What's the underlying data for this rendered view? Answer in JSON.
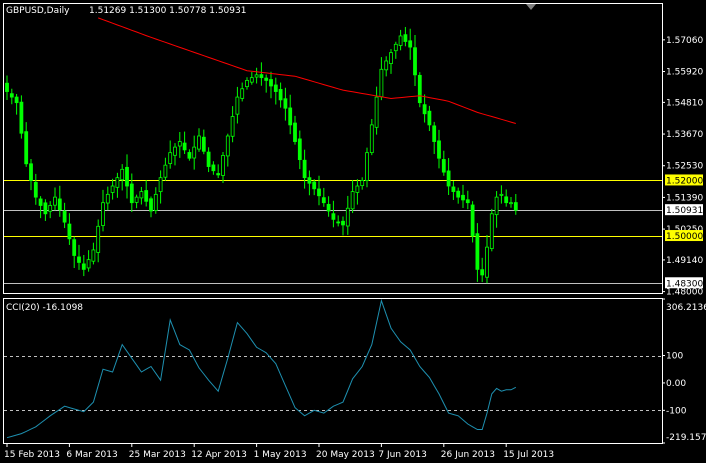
{
  "window": {
    "symbol_label": "GBPUSD,Daily",
    "ohlc_label": "1.51269 1.51300 1.50778 1.50931"
  },
  "colors": {
    "background": "#000000",
    "frame": "#ffffff",
    "candle": "#00ff00",
    "moving_average": "#ff0000",
    "hline_yellow": "#ffff00",
    "hline_white": "#c0c0c0",
    "cci_line": "#1e90b0",
    "text": "#ffffff",
    "tag_yellow_bg": "#ffff00",
    "tag_white_bg": "#ffffff",
    "tag_text": "#000000"
  },
  "chart_data": [
    {
      "type": "candlestick",
      "title": "GBPUSD,Daily",
      "ylim": [
        1.4795,
        1.5835
      ],
      "y_ticks": [
        "1.57060",
        "1.55920",
        "1.54810",
        "1.53670",
        "1.52530",
        "1.51390",
        "1.50250",
        "1.49140",
        "1.48000"
      ],
      "x_tick_labels": [
        "15 Feb 2013",
        "6 Mar 2013",
        "25 Mar 2013",
        "12 Apr 2013",
        "1 May 2013",
        "20 May 2013",
        "7 Jun 2013",
        "26 Jun 2013",
        "15 Jul 2013"
      ],
      "x_tick_bar_index": [
        0,
        13,
        26,
        39,
        52,
        65,
        78,
        91,
        104
      ],
      "bar_count": 107,
      "ma_start_index": 19,
      "horizontal_lines": [
        {
          "value": 1.52,
          "label": "1.52000",
          "style": "yellow"
        },
        {
          "value": 1.50931,
          "label": "1.50931",
          "style": "white"
        },
        {
          "value": 1.5,
          "label": "1.50000",
          "style": "yellow"
        },
        {
          "value": 1.483,
          "label": "1.48300",
          "style": "white"
        }
      ],
      "close_keyframes": [
        [
          0,
          1.552
        ],
        [
          2,
          1.548
        ],
        [
          4,
          1.526
        ],
        [
          6,
          1.514
        ],
        [
          8,
          1.508
        ],
        [
          10,
          1.514
        ],
        [
          12,
          1.505
        ],
        [
          14,
          1.493
        ],
        [
          16,
          1.488
        ],
        [
          18,
          1.495
        ],
        [
          20,
          1.512
        ],
        [
          22,
          1.518
        ],
        [
          24,
          1.524
        ],
        [
          26,
          1.512
        ],
        [
          28,
          1.516
        ],
        [
          30,
          1.509
        ],
        [
          32,
          1.521
        ],
        [
          34,
          1.53
        ],
        [
          36,
          1.534
        ],
        [
          38,
          1.528
        ],
        [
          40,
          1.536
        ],
        [
          42,
          1.525
        ],
        [
          44,
          1.522
        ],
        [
          46,
          1.536
        ],
        [
          48,
          1.55
        ],
        [
          50,
          1.556
        ],
        [
          52,
          1.558
        ],
        [
          54,
          1.556
        ],
        [
          56,
          1.552
        ],
        [
          58,
          1.546
        ],
        [
          60,
          1.534
        ],
        [
          62,
          1.521
        ],
        [
          64,
          1.517
        ],
        [
          66,
          1.512
        ],
        [
          68,
          1.506
        ],
        [
          70,
          1.504
        ],
        [
          72,
          1.516
        ],
        [
          74,
          1.52
        ],
        [
          76,
          1.54
        ],
        [
          78,
          1.56
        ],
        [
          80,
          1.566
        ],
        [
          82,
          1.572
        ],
        [
          84,
          1.568
        ],
        [
          86,
          1.548
        ],
        [
          88,
          1.54
        ],
        [
          90,
          1.528
        ],
        [
          92,
          1.518
        ],
        [
          94,
          1.514
        ],
        [
          96,
          1.512
        ],
        [
          98,
          1.488
        ],
        [
          99,
          1.486
        ],
        [
          100,
          1.496
        ],
        [
          101,
          1.508
        ],
        [
          102,
          1.514
        ],
        [
          103,
          1.515
        ],
        [
          104,
          1.512
        ],
        [
          105,
          1.512
        ],
        [
          106,
          1.5093
        ]
      ],
      "moving_average_keyframes": [
        [
          19,
          1.5785
        ],
        [
          30,
          1.5715
        ],
        [
          40,
          1.5655
        ],
        [
          50,
          1.5595
        ],
        [
          60,
          1.5575
        ],
        [
          70,
          1.5525
        ],
        [
          80,
          1.5495
        ],
        [
          86,
          1.5505
        ],
        [
          92,
          1.5485
        ],
        [
          98,
          1.5445
        ],
        [
          106,
          1.5405
        ]
      ]
    },
    {
      "type": "line",
      "title": "CCI(20) -16.1098",
      "ylim": [
        -219.1573,
        306.2136
      ],
      "y_ticks": [
        "306.2136",
        "100",
        "0.00",
        "-100",
        "-219.1573"
      ],
      "dashed_levels": [
        100,
        -100
      ],
      "series": [
        {
          "keyframes": [
            [
              0,
              -200
            ],
            [
              3,
              -185
            ],
            [
              6,
              -160
            ],
            [
              9,
              -120
            ],
            [
              12,
              -85
            ],
            [
              14,
              -95
            ],
            [
              16,
              -105
            ],
            [
              18,
              -70
            ],
            [
              20,
              50
            ],
            [
              22,
              40
            ],
            [
              24,
              140
            ],
            [
              26,
              90
            ],
            [
              28,
              40
            ],
            [
              30,
              60
            ],
            [
              32,
              10
            ],
            [
              34,
              230
            ],
            [
              36,
              140
            ],
            [
              38,
              120
            ],
            [
              40,
              55
            ],
            [
              42,
              10
            ],
            [
              44,
              -30
            ],
            [
              46,
              90
            ],
            [
              48,
              220
            ],
            [
              50,
              180
            ],
            [
              52,
              130
            ],
            [
              54,
              110
            ],
            [
              56,
              70
            ],
            [
              58,
              -10
            ],
            [
              60,
              -90
            ],
            [
              62,
              -120
            ],
            [
              64,
              -100
            ],
            [
              66,
              -110
            ],
            [
              68,
              -85
            ],
            [
              70,
              -70
            ],
            [
              72,
              15
            ],
            [
              74,
              60
            ],
            [
              76,
              140
            ],
            [
              78,
              300
            ],
            [
              80,
              200
            ],
            [
              82,
              150
            ],
            [
              84,
              120
            ],
            [
              86,
              60
            ],
            [
              88,
              20
            ],
            [
              90,
              -40
            ],
            [
              92,
              -110
            ],
            [
              94,
              -120
            ],
            [
              96,
              -150
            ],
            [
              98,
              -170
            ],
            [
              99,
              -170
            ],
            [
              100,
              -110
            ],
            [
              101,
              -40
            ],
            [
              102,
              -20
            ],
            [
              103,
              -30
            ],
            [
              104,
              -25
            ],
            [
              105,
              -25
            ],
            [
              106,
              -16.1098
            ]
          ]
        }
      ]
    }
  ]
}
